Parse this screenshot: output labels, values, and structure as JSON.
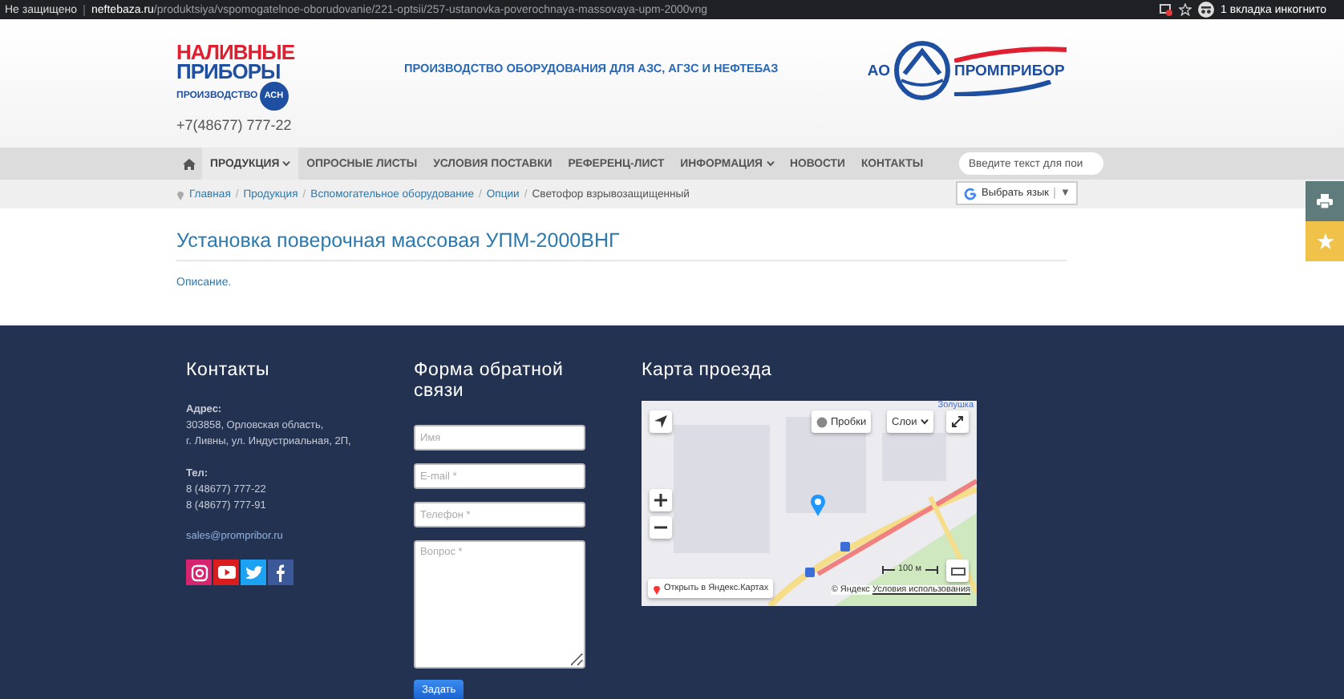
{
  "browser_bar": {
    "security": "Не защищено",
    "url": "**neftebaza.ru**/produktsiya/vspomogatelnoe-oborudovanie/221-optsii/257-ustanovka-poverochnaya-massovaya-upm-2000vng",
    "profile": "1 вкладка инкогнито"
  },
  "header": {
    "logo_line_1": "НАЛИВНЫЕ",
    "logo_line_2": "ПРИБОРЫ",
    "logo_line_3": "ПРОИЗВОДСТВО",
    "logo_badge": "АСН",
    "phone": "+7(48677) 777-22",
    "tagline": "ПРОИЗВОДСТВО ОБОРУДОВАНИЯ ДЛЯ АЗС, АГЗС И НЕФТЕБАЗ",
    "brand_prefix": "АО",
    "brand_name": "ПРОМПРИБОР"
  },
  "nav": {
    "items": [
      {
        "label": "ПРОДУКЦИЯ",
        "dropdown": true,
        "selected": true
      },
      {
        "label": "ОПРОСНЫЕ ЛИСТЫ",
        "dropdown": false,
        "selected": false
      },
      {
        "label": "УСЛОВИЯ ПОСТАВКИ",
        "dropdown": false,
        "selected": false
      },
      {
        "label": "РЕФЕРЕНЦ-ЛИСТ",
        "dropdown": false,
        "selected": false
      },
      {
        "label": "ИНФОРМАЦИЯ",
        "dropdown": true,
        "selected": false
      },
      {
        "label": "НОВОСТИ",
        "dropdown": false,
        "selected": false
      },
      {
        "label": "КОНТАКТЫ",
        "dropdown": false,
        "selected": false
      }
    ],
    "search": {
      "placeholder": "Введите текст для пои"
    }
  },
  "breadcrumb_separator": "/",
  "breadcrumbs": [
    "Главная",
    "Продукция",
    "Вспомогательное оборудование",
    "Опции",
    "Светофор взрывозащищенный"
  ],
  "language": {
    "label": "Выбрать язык",
    "arrow": "▼"
  },
  "page": {
    "title": "Установка поверочная массовая УПМ-2000ВНГ",
    "description": "Описание."
  },
  "footer": {
    "contacts": {
      "title": "Контакты",
      "address_label": "Адрес:",
      "address_lines": [
        "303858, Орловская область,",
        "г. Ливны, ул. Индустриальная, 2П,"
      ],
      "phone_label": "Тел:",
      "phones": [
        "8 (48677) 777-22",
        "8 (48677) 777-91"
      ],
      "email": "sales@prompribor.ru"
    },
    "form": {
      "title": "Форма обратной связи",
      "fields": [
        {
          "kind": "input",
          "placeholder": "Имя"
        },
        {
          "kind": "input",
          "placeholder": "E-mail *"
        },
        {
          "kind": "input",
          "placeholder": "Телефон *"
        },
        {
          "kind": "textarea",
          "placeholder": "Вопрос *"
        }
      ],
      "submit": "Задать"
    },
    "map": {
      "title": "Карта проезда",
      "traffic": "Пробки",
      "layers": "Слои",
      "corner_label": "Золушка",
      "scale": "100 м",
      "open_link": "Открыть в Яндекс.Картах",
      "copyright": "© Яндекс",
      "terms": "Условия использования"
    }
  }
}
